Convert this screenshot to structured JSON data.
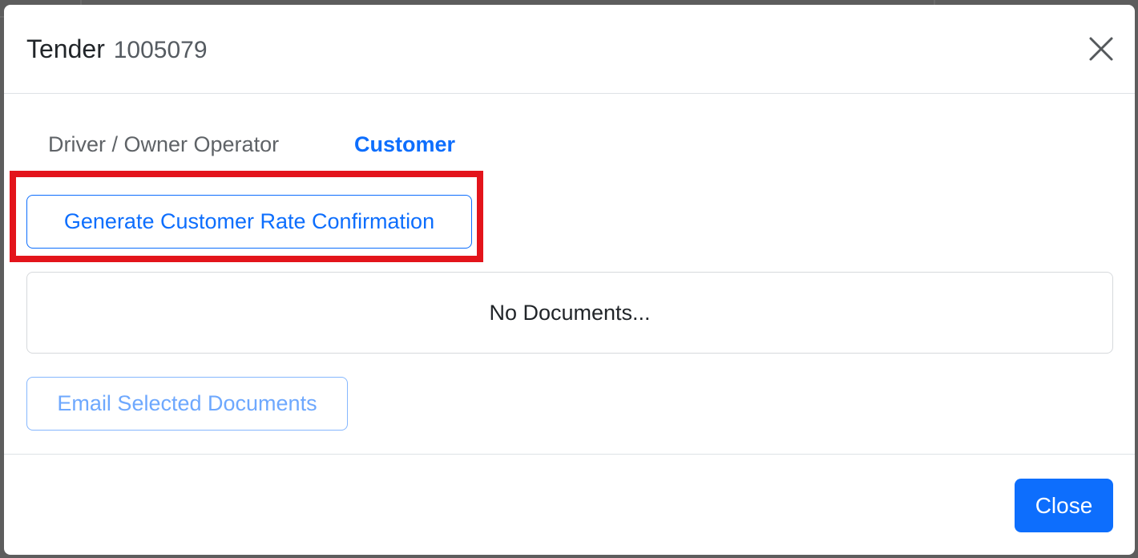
{
  "modal": {
    "title": "Tender",
    "tender_id": "1005079",
    "close_icon": "close-icon"
  },
  "tabs": [
    {
      "label": "Driver / Owner Operator",
      "active": false
    },
    {
      "label": "Customer",
      "active": true
    }
  ],
  "actions": {
    "generate_label": "Generate Customer Rate Confirmation",
    "email_label": "Email Selected Documents"
  },
  "documents": {
    "empty_text": "No Documents..."
  },
  "footer": {
    "close_label": "Close"
  },
  "colors": {
    "accent": "#0d6efd",
    "highlight": "#e3141b",
    "disabled_accent": "#6ea8fe"
  }
}
